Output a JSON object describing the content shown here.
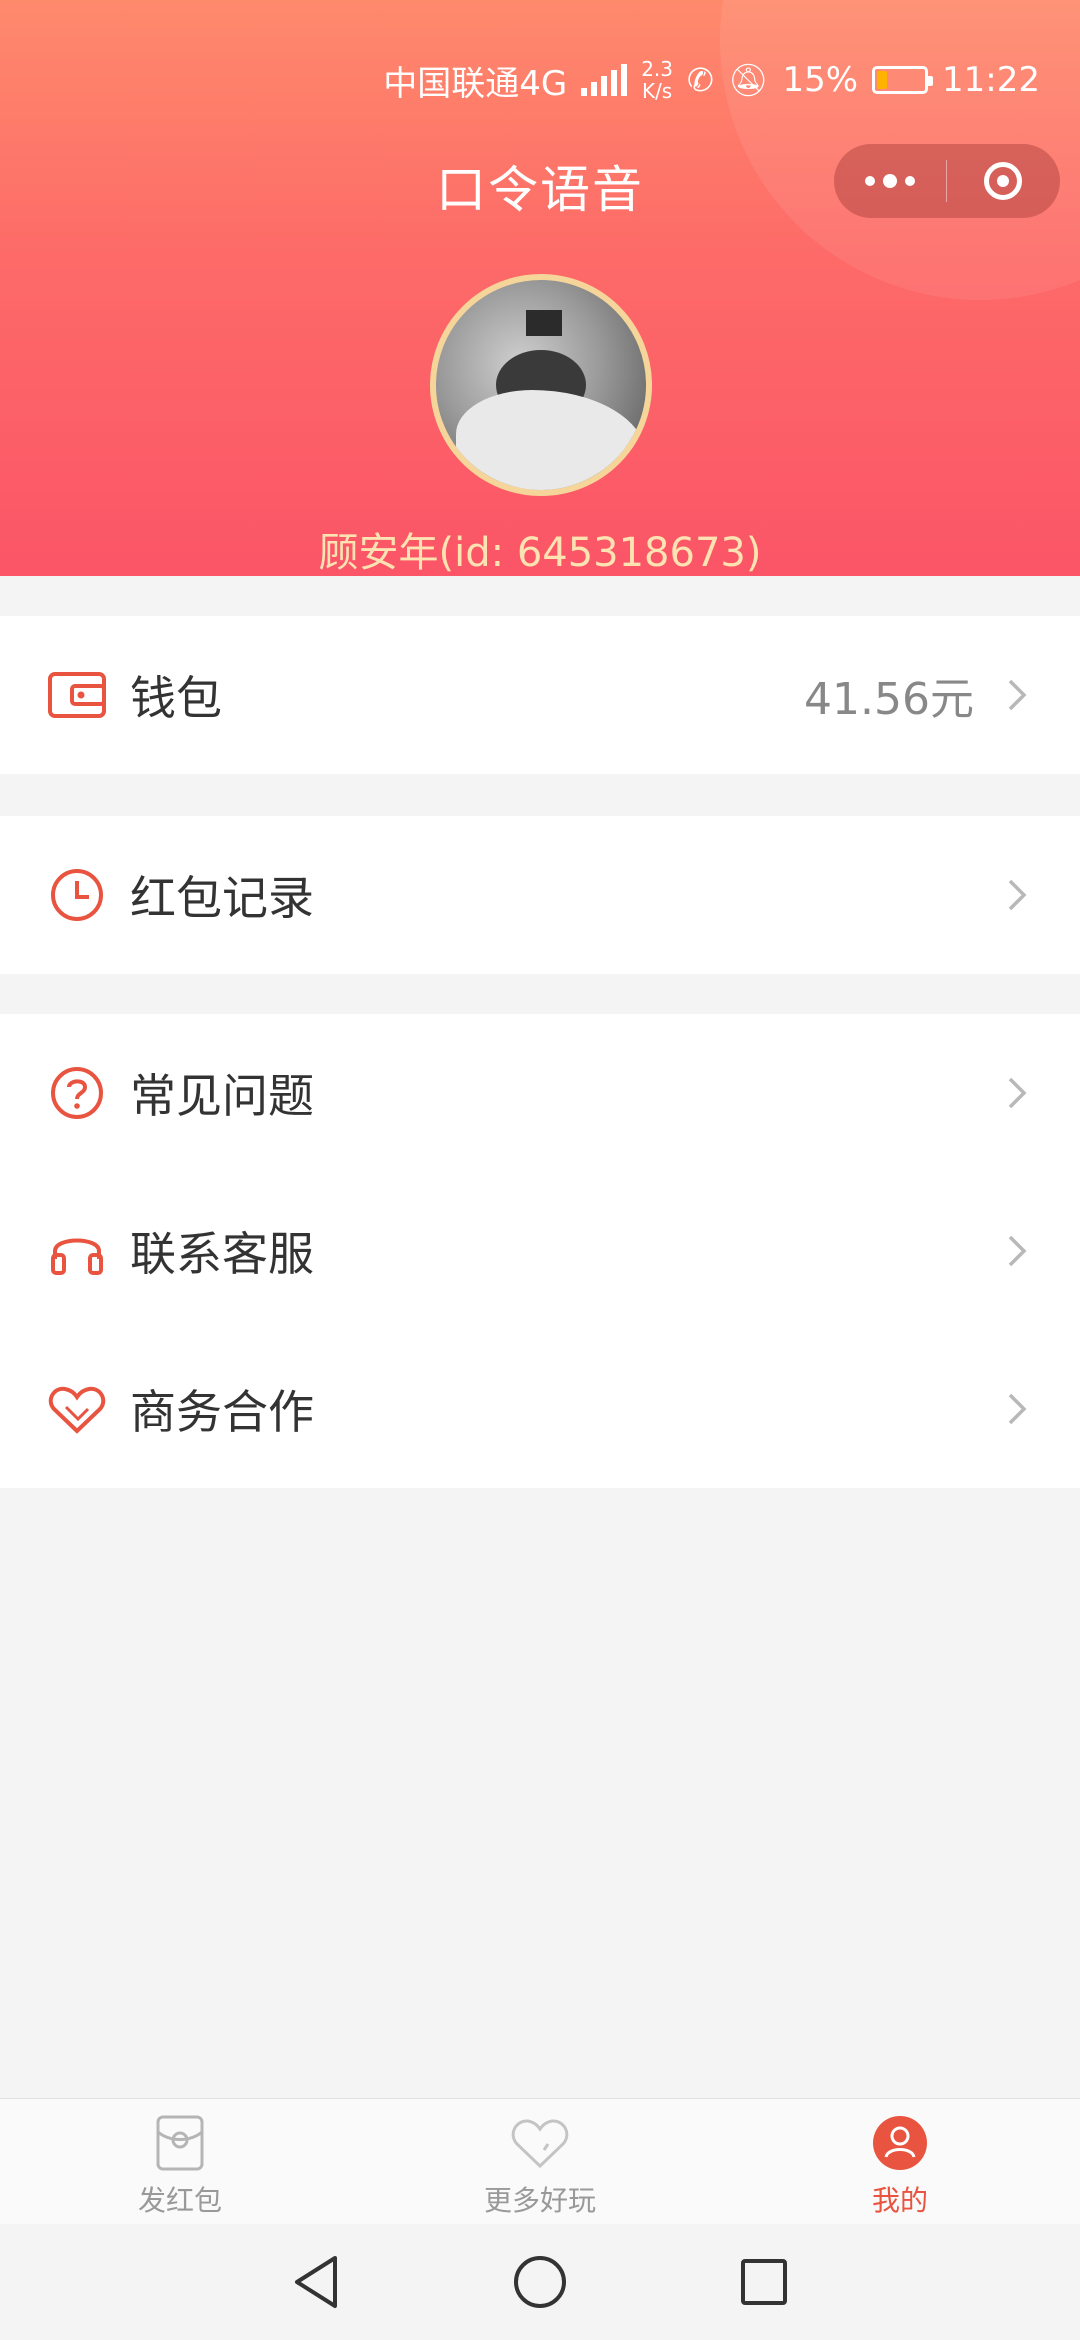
{
  "status_bar": {
    "carrier": "中国联通4G",
    "network_small": "4G",
    "speed_value": "2.3",
    "speed_unit": "K/s",
    "battery": "15%",
    "time": "11:22"
  },
  "header": {
    "title": "口令语音",
    "user_name": "顾安年(id: 645318673)"
  },
  "menu": {
    "wallet": {
      "label": "钱包",
      "value": "41.56元"
    },
    "records": {
      "label": "红包记录"
    },
    "faq": {
      "label": "常见问题"
    },
    "service": {
      "label": "联系客服"
    },
    "business": {
      "label": "商务合作"
    }
  },
  "tabbar": {
    "tabs": [
      {
        "label": "发红包",
        "icon": "red-envelope-icon",
        "active": false
      },
      {
        "label": "更多好玩",
        "icon": "heart-outline-icon",
        "active": false
      },
      {
        "label": "我的",
        "icon": "user-icon",
        "active": true
      }
    ]
  },
  "colors": {
    "accent": "#e8543f",
    "header_top": "#fe8a6c",
    "header_bottom": "#fb5567",
    "name_text": "#fde2b2",
    "avatar_border": "#f5d59a"
  }
}
